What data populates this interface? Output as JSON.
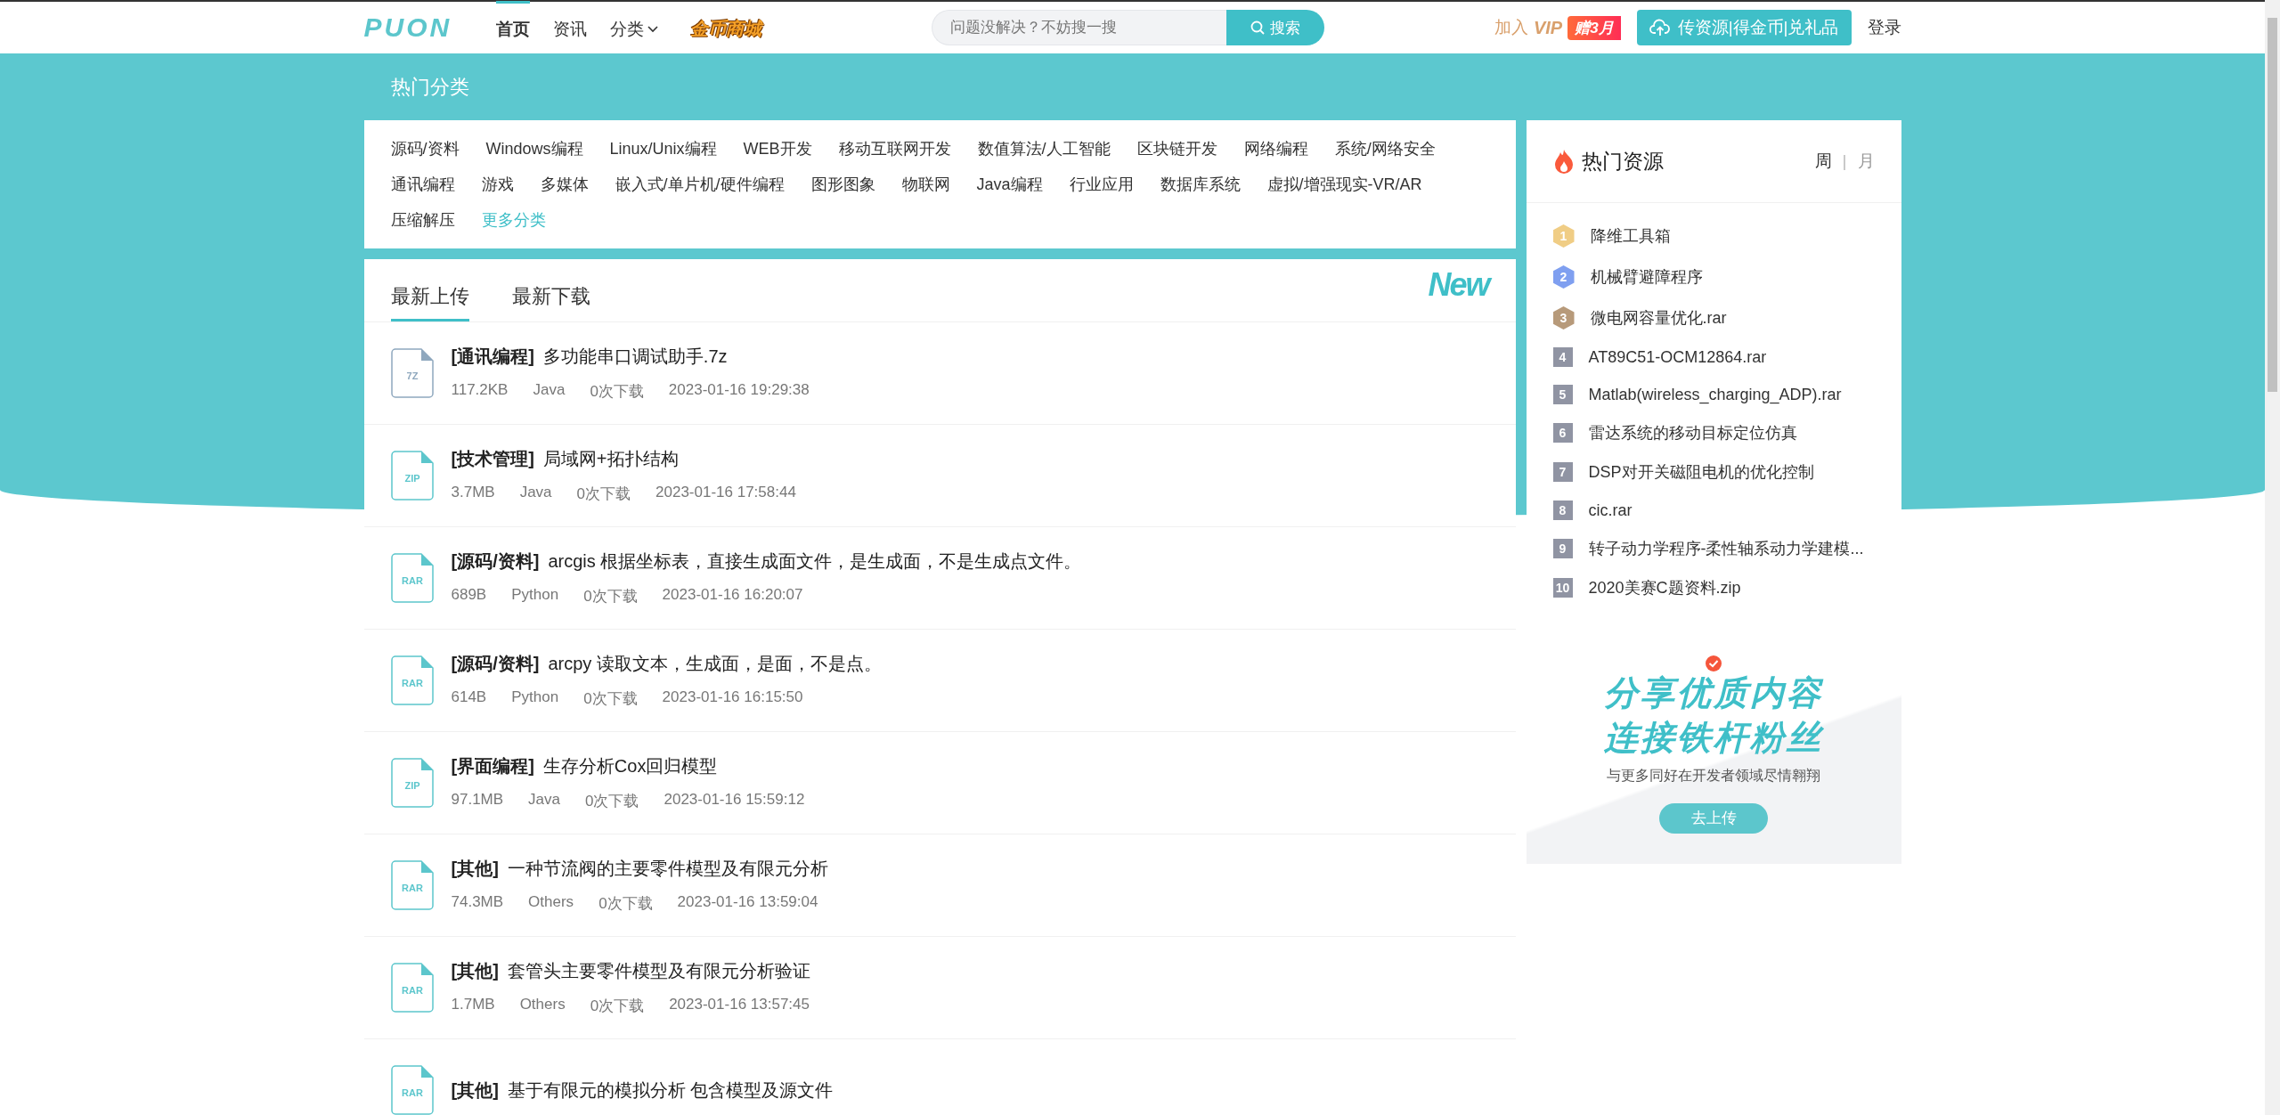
{
  "header": {
    "logo": "PUON",
    "nav": [
      {
        "label": "首页",
        "selected": true,
        "kind": "link"
      },
      {
        "label": "资讯",
        "selected": false,
        "kind": "link"
      },
      {
        "label": "分类",
        "selected": false,
        "kind": "dropdown"
      },
      {
        "label": "金币商城",
        "selected": false,
        "kind": "promo"
      }
    ],
    "search": {
      "placeholder": "问题没解决？不妨搜一搜",
      "button": "搜索"
    },
    "vip": {
      "join": "加入",
      "vip": "VIP",
      "badge": "赠3月"
    },
    "upload_button": "传资源|得金币|兑礼品",
    "login": "登录"
  },
  "categories": {
    "title": "热门分类",
    "items": [
      {
        "label": "源码/资料",
        "kind": "category"
      },
      {
        "label": "Windows编程",
        "kind": "category"
      },
      {
        "label": "Linux/Unix编程",
        "kind": "category"
      },
      {
        "label": "WEB开发",
        "kind": "category"
      },
      {
        "label": "移动互联网开发",
        "kind": "category"
      },
      {
        "label": "数值算法/人工智能",
        "kind": "category"
      },
      {
        "label": "区块链开发",
        "kind": "category"
      },
      {
        "label": "网络编程",
        "kind": "category"
      },
      {
        "label": "系统/网络安全",
        "kind": "category"
      },
      {
        "label": "通讯编程",
        "kind": "category"
      },
      {
        "label": "游戏",
        "kind": "category"
      },
      {
        "label": "多媒体",
        "kind": "category"
      },
      {
        "label": "嵌入式/单片机/硬件编程",
        "kind": "category"
      },
      {
        "label": "图形图象",
        "kind": "category"
      },
      {
        "label": "物联网",
        "kind": "category"
      },
      {
        "label": "Java编程",
        "kind": "category"
      },
      {
        "label": "行业应用",
        "kind": "category"
      },
      {
        "label": "数据库系统",
        "kind": "category"
      },
      {
        "label": "虚拟/增强现实-VR/AR",
        "kind": "category"
      },
      {
        "label": "压缩解压",
        "kind": "category"
      },
      {
        "label": "更多分类",
        "kind": "more"
      }
    ]
  },
  "uploads": {
    "tabs": [
      {
        "label": "最新上传",
        "selected": true
      },
      {
        "label": "最新下载",
        "selected": false
      }
    ],
    "badge": "New",
    "rows": [
      {
        "ext": "7Z",
        "color": "#8fa8be",
        "category": "[通讯编程]",
        "title": "多功能串口调试助手.7z",
        "size": "117.2KB",
        "language": "Java",
        "downloads": "0次下载",
        "time": "2023-01-16 19:29:38"
      },
      {
        "ext": "ZIP",
        "color": "#5cc6cc",
        "category": "[技术管理]",
        "title": "局域网+拓扑结构",
        "size": "3.7MB",
        "language": "Java",
        "downloads": "0次下载",
        "time": "2023-01-16 17:58:44"
      },
      {
        "ext": "RAR",
        "color": "#5cc6cc",
        "category": "[源码/资料]",
        "title": "arcgis 根据坐标表，直接生成面文件，是生成面，不是生成点文件。",
        "size": "689B",
        "language": "Python",
        "downloads": "0次下载",
        "time": "2023-01-16 16:20:07"
      },
      {
        "ext": "RAR",
        "color": "#5cc6cc",
        "category": "[源码/资料]",
        "title": "arcpy 读取文本，生成面，是面，不是点。",
        "size": "614B",
        "language": "Python",
        "downloads": "0次下载",
        "time": "2023-01-16 16:15:50"
      },
      {
        "ext": "ZIP",
        "color": "#5cc6cc",
        "category": "[界面编程]",
        "title": "生存分析Cox回归模型",
        "size": "97.1MB",
        "language": "Java",
        "downloads": "0次下载",
        "time": "2023-01-16 15:59:12"
      },
      {
        "ext": "RAR",
        "color": "#5cc6cc",
        "category": "[其他]",
        "title": "一种节流阀的主要零件模型及有限元分析",
        "size": "74.3MB",
        "language": "Others",
        "downloads": "0次下载",
        "time": "2023-01-16 13:59:04"
      },
      {
        "ext": "RAR",
        "color": "#5cc6cc",
        "category": "[其他]",
        "title": "套管头主要零件模型及有限元分析验证",
        "size": "1.7MB",
        "language": "Others",
        "downloads": "0次下载",
        "time": "2023-01-16 13:57:45"
      },
      {
        "ext": "RAR",
        "color": "#5cc6cc",
        "category": "[其他]",
        "title": "基于有限元的模拟分析 包含模型及源文件"
      }
    ]
  },
  "hot": {
    "title": "热门资源",
    "periods": [
      {
        "label": "周",
        "selected": true
      },
      {
        "label": "月",
        "selected": false
      }
    ],
    "separator": "|",
    "items": [
      {
        "rank": "1",
        "kind": "medal",
        "color": "#f0cd85",
        "title": "降维工具箱"
      },
      {
        "rank": "2",
        "kind": "medal",
        "color": "#7f9ff0",
        "title": "机械臂避障程序"
      },
      {
        "rank": "3",
        "kind": "medal",
        "color": "#b79a7a",
        "title": "微电网容量优化.rar"
      },
      {
        "rank": "4",
        "kind": "plain",
        "color": "#9094a3",
        "title": "AT89C51-OCM12864.rar"
      },
      {
        "rank": "5",
        "kind": "plain",
        "color": "#9094a3",
        "title": "Matlab(wireless_charging_ADP).rar"
      },
      {
        "rank": "6",
        "kind": "plain",
        "color": "#9094a3",
        "title": "雷达系统的移动目标定位仿真"
      },
      {
        "rank": "7",
        "kind": "plain",
        "color": "#9094a3",
        "title": "DSP对开关磁阻电机的优化控制"
      },
      {
        "rank": "8",
        "kind": "plain",
        "color": "#9094a3",
        "title": "cic.rar"
      },
      {
        "rank": "9",
        "kind": "plain",
        "color": "#9094a3",
        "title": "转子动力学程序-柔性轴系动力学建模..."
      },
      {
        "rank": "10",
        "kind": "plain",
        "color": "#9094a3",
        "title": "2020美赛C题资料.zip"
      }
    ]
  },
  "promo": {
    "line1": "分享优质内容",
    "line2": "连接铁杆粉丝",
    "subtitle": "与更多同好在开发者领域尽情翱翔",
    "button": "去上传"
  }
}
